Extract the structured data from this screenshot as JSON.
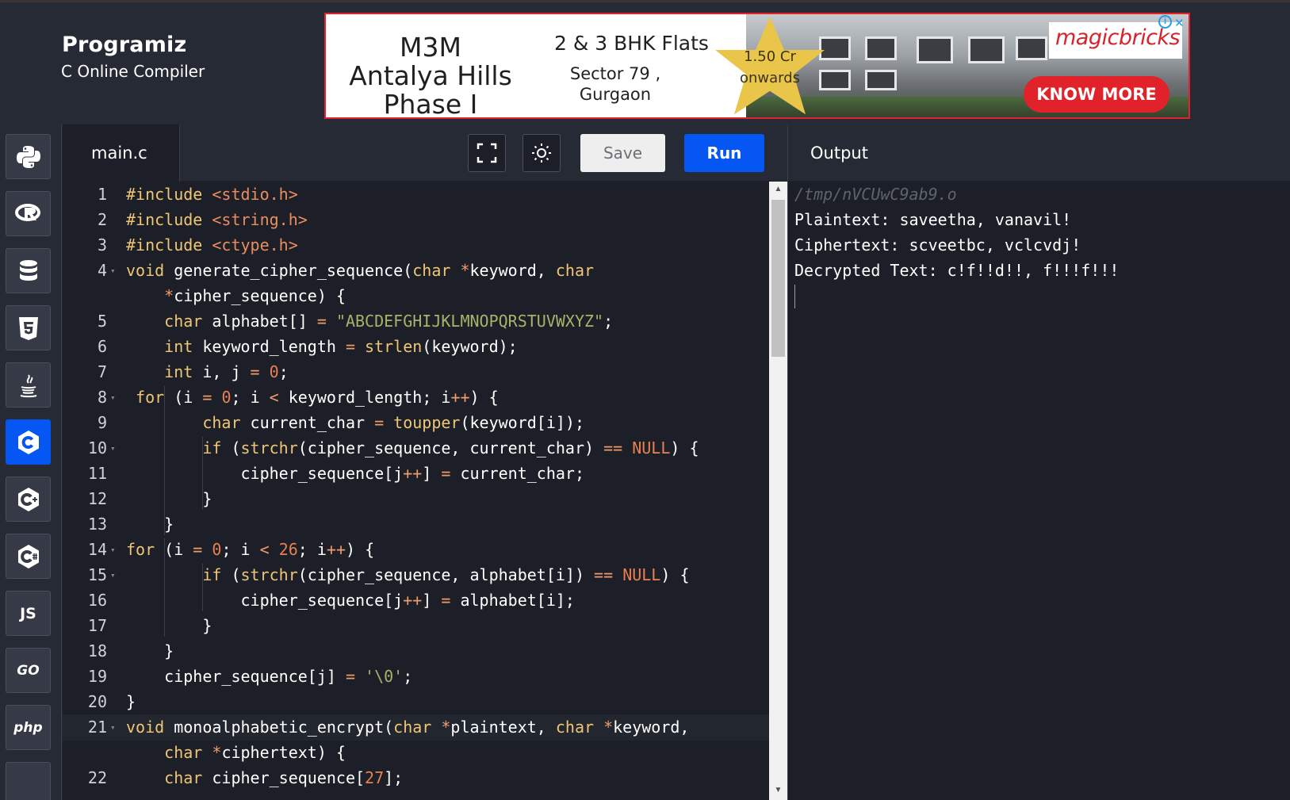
{
  "brand": {
    "logo": "Programiz",
    "subtitle": "C Online Compiler"
  },
  "ad": {
    "title": "M3M Antalya Hills Phase I",
    "flats": "2 & 3 BHK Flats",
    "location": "Sector 79 , Gurgaon",
    "price": "1.50 Cr onwards",
    "brand": "magicbricks",
    "cta": "KNOW MORE",
    "info_icon": "info-icon",
    "close_icon": "close-icon"
  },
  "languages": [
    {
      "name": "python-icon",
      "label": ""
    },
    {
      "name": "r-icon",
      "label": "R"
    },
    {
      "name": "sql-icon",
      "label": ""
    },
    {
      "name": "html-icon",
      "label": "5"
    },
    {
      "name": "java-icon",
      "label": ""
    },
    {
      "name": "c-icon",
      "label": "C",
      "active": true
    },
    {
      "name": "cpp-icon",
      "label": "C"
    },
    {
      "name": "csharp-icon",
      "label": "C"
    },
    {
      "name": "javascript-icon",
      "label": "JS"
    },
    {
      "name": "go-icon",
      "label": "GO"
    },
    {
      "name": "php-icon",
      "label": "php"
    }
  ],
  "editor": {
    "filename": "main.c",
    "fullscreen_icon": "fullscreen-icon",
    "theme_icon": "sun-icon",
    "save_label": "Save",
    "run_label": "Run"
  },
  "code_lines": [
    {
      "n": "1",
      "tokens": [
        [
          "#include ",
          "kw"
        ],
        [
          "<stdio.h>",
          "inc"
        ]
      ]
    },
    {
      "n": "2",
      "tokens": [
        [
          "#include ",
          "kw"
        ],
        [
          "<string.h>",
          "inc"
        ]
      ]
    },
    {
      "n": "3",
      "tokens": [
        [
          "#include ",
          "kw"
        ],
        [
          "<ctype.h>",
          "inc"
        ]
      ]
    },
    {
      "n": "4",
      "fold": true,
      "tokens": [
        [
          "void",
          "kw"
        ],
        [
          " generate_cipher_sequence(",
          "id"
        ],
        [
          "char",
          "kw"
        ],
        [
          " ",
          "id"
        ],
        [
          "*",
          "op"
        ],
        [
          "keyword, ",
          "id"
        ],
        [
          "char",
          "kw"
        ]
      ]
    },
    {
      "n": "",
      "tokens": [
        [
          "    ",
          "id"
        ],
        [
          "*",
          "op"
        ],
        [
          "cipher_sequence) {",
          "id"
        ]
      ]
    },
    {
      "n": "5",
      "tokens": [
        [
          "    ",
          "id"
        ],
        [
          "char",
          "kw"
        ],
        [
          " alphabet[] ",
          "id"
        ],
        [
          "=",
          "op"
        ],
        [
          " ",
          "id"
        ],
        [
          "\"ABCDEFGHIJKLMNOPQRSTUVWXYZ\"",
          "str"
        ],
        [
          ";",
          "id"
        ]
      ]
    },
    {
      "n": "6",
      "tokens": [
        [
          "    ",
          "id"
        ],
        [
          "int",
          "kw"
        ],
        [
          " keyword_length ",
          "id"
        ],
        [
          "=",
          "op"
        ],
        [
          " ",
          "id"
        ],
        [
          "strlen",
          "fn"
        ],
        [
          "(keyword);",
          "id"
        ]
      ]
    },
    {
      "n": "7",
      "tokens": [
        [
          "    ",
          "id"
        ],
        [
          "int",
          "kw"
        ],
        [
          " i, j ",
          "id"
        ],
        [
          "=",
          "op"
        ],
        [
          " ",
          "id"
        ],
        [
          "0",
          "num"
        ],
        [
          ";",
          "id"
        ]
      ]
    },
    {
      "n": "8",
      "fold": true,
      "tokens": [
        [
          " ",
          "id"
        ],
        [
          "for",
          "kw"
        ],
        [
          " (i ",
          "id"
        ],
        [
          "=",
          "op"
        ],
        [
          " ",
          "id"
        ],
        [
          "0",
          "num"
        ],
        [
          "; i ",
          "id"
        ],
        [
          "<",
          "op"
        ],
        [
          " keyword_length; i",
          "id"
        ],
        [
          "++",
          "op"
        ],
        [
          ") {",
          "id"
        ]
      ]
    },
    {
      "n": "9",
      "tokens": [
        [
          "        ",
          "id"
        ],
        [
          "char",
          "kw"
        ],
        [
          " current_char ",
          "id"
        ],
        [
          "=",
          "op"
        ],
        [
          " ",
          "id"
        ],
        [
          "toupper",
          "fn"
        ],
        [
          "(keyword[i]);",
          "id"
        ]
      ]
    },
    {
      "n": "10",
      "fold": true,
      "tokens": [
        [
          "        ",
          "id"
        ],
        [
          "if",
          "kw"
        ],
        [
          " (",
          "id"
        ],
        [
          "strchr",
          "fn"
        ],
        [
          "(cipher_sequence, current_char) ",
          "id"
        ],
        [
          "==",
          "op"
        ],
        [
          " ",
          "id"
        ],
        [
          "NULL",
          "num"
        ],
        [
          ") {",
          "id"
        ]
      ]
    },
    {
      "n": "11",
      "tokens": [
        [
          "            cipher_sequence[j",
          "id"
        ],
        [
          "++",
          "op"
        ],
        [
          "] ",
          "id"
        ],
        [
          "=",
          "op"
        ],
        [
          " current_char;",
          "id"
        ]
      ]
    },
    {
      "n": "12",
      "tokens": [
        [
          "        }",
          "id"
        ]
      ]
    },
    {
      "n": "13",
      "tokens": [
        [
          "    }",
          "id"
        ]
      ]
    },
    {
      "n": "14",
      "fold": true,
      "tokens": [
        [
          "for",
          "kw"
        ],
        [
          " (i ",
          "id"
        ],
        [
          "=",
          "op"
        ],
        [
          " ",
          "id"
        ],
        [
          "0",
          "num"
        ],
        [
          "; i ",
          "id"
        ],
        [
          "<",
          "op"
        ],
        [
          " ",
          "id"
        ],
        [
          "26",
          "num"
        ],
        [
          "; i",
          "id"
        ],
        [
          "++",
          "op"
        ],
        [
          ") {",
          "id"
        ]
      ]
    },
    {
      "n": "15",
      "fold": true,
      "tokens": [
        [
          "        ",
          "id"
        ],
        [
          "if",
          "kw"
        ],
        [
          " (",
          "id"
        ],
        [
          "strchr",
          "fn"
        ],
        [
          "(cipher_sequence, alphabet[i]) ",
          "id"
        ],
        [
          "==",
          "op"
        ],
        [
          " ",
          "id"
        ],
        [
          "NULL",
          "num"
        ],
        [
          ") {",
          "id"
        ]
      ]
    },
    {
      "n": "16",
      "tokens": [
        [
          "            cipher_sequence[j",
          "id"
        ],
        [
          "++",
          "op"
        ],
        [
          "] ",
          "id"
        ],
        [
          "=",
          "op"
        ],
        [
          " alphabet[i];",
          "id"
        ]
      ]
    },
    {
      "n": "17",
      "tokens": [
        [
          "        }",
          "id"
        ]
      ]
    },
    {
      "n": "18",
      "tokens": [
        [
          "    }",
          "id"
        ]
      ]
    },
    {
      "n": "19",
      "tokens": [
        [
          "    cipher_sequence[j] ",
          "id"
        ],
        [
          "=",
          "op"
        ],
        [
          " ",
          "id"
        ],
        [
          "'\\0'",
          "str"
        ],
        [
          ";",
          "id"
        ]
      ]
    },
    {
      "n": "20",
      "tokens": [
        [
          "}",
          "id"
        ]
      ]
    },
    {
      "n": "21",
      "fold": true,
      "hl": true,
      "tokens": [
        [
          "void",
          "kw"
        ],
        [
          " monoalphabetic_encrypt(",
          "id"
        ],
        [
          "char",
          "kw"
        ],
        [
          " ",
          "id"
        ],
        [
          "*",
          "op"
        ],
        [
          "plaintext, ",
          "id"
        ],
        [
          "char",
          "kw"
        ],
        [
          " ",
          "id"
        ],
        [
          "*",
          "op"
        ],
        [
          "keyword,",
          "id"
        ]
      ]
    },
    {
      "n": "",
      "tokens": [
        [
          "    ",
          "id"
        ],
        [
          "char",
          "kw"
        ],
        [
          " ",
          "id"
        ],
        [
          "*",
          "op"
        ],
        [
          "ciphertext) {",
          "id"
        ]
      ]
    },
    {
      "n": "22",
      "tokens": [
        [
          "    ",
          "id"
        ],
        [
          "char",
          "kw"
        ],
        [
          " cipher_sequence[",
          "id"
        ],
        [
          "27",
          "num"
        ],
        [
          "];",
          "id"
        ]
      ]
    }
  ],
  "output": {
    "title": "Output",
    "lines": [
      "/tmp/nVCUwC9ab9.o",
      "Plaintext: saveetha, vanavil!",
      "Ciphertext: scveetbc, vclcvdj!",
      "Decrypted Text: c!f!!d!!, f!!!f!!!"
    ]
  },
  "colors": {
    "kw": "#f0c674",
    "inc": "#ea8d5f",
    "str": "#a9b26a",
    "num": "#ea7f52",
    "op": "#f09b6a",
    "fn": "#f0c674",
    "id": "#ffffff",
    "accent": "#0556f3"
  }
}
